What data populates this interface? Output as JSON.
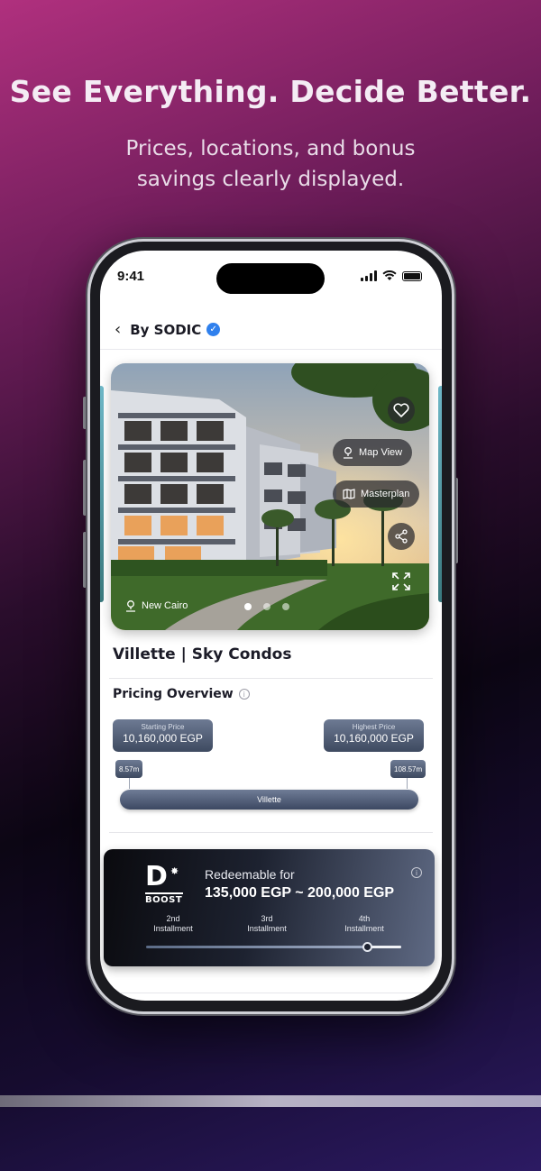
{
  "headline": "See Everything. Decide Better.",
  "subline": "Prices, locations, and bonus savings clearly displayed.",
  "status": {
    "time": "9:41"
  },
  "nav": {
    "back_icon": "chevron-left-icon",
    "title": "By SODIC",
    "verified_icon": "verified-badge-icon"
  },
  "hero": {
    "map_view_label": "Map View",
    "masterplan_label": "Masterplan",
    "location": "New Cairo",
    "slide_count": 3,
    "active_slide": 1
  },
  "project": {
    "name": "Villette | Sky Condos"
  },
  "pricing": {
    "title": "Pricing Overview",
    "starting_label": "Starting Price",
    "starting_value": "10,160,000 EGP",
    "highest_label": "Highest Price",
    "highest_value": "10,160,000 EGP",
    "min_tick": "8.57m",
    "max_tick": "108.57m",
    "range_label": "Villette"
  },
  "boost": {
    "logo_letter": "D",
    "logo_word": "BOOST",
    "redeemable_label": "Redeemable for",
    "range": "135,000 EGP ~ 200,000 EGP",
    "installments": [
      {
        "num": "2nd",
        "label": "Installment"
      },
      {
        "num": "3rd",
        "label": "Installment"
      },
      {
        "num": "4th",
        "label": "Installment"
      }
    ],
    "progress": 0.84
  },
  "colors": {
    "accent": "#2f80ed",
    "bg_top": "#b0307e",
    "bg_bottom": "#2c1a63"
  }
}
